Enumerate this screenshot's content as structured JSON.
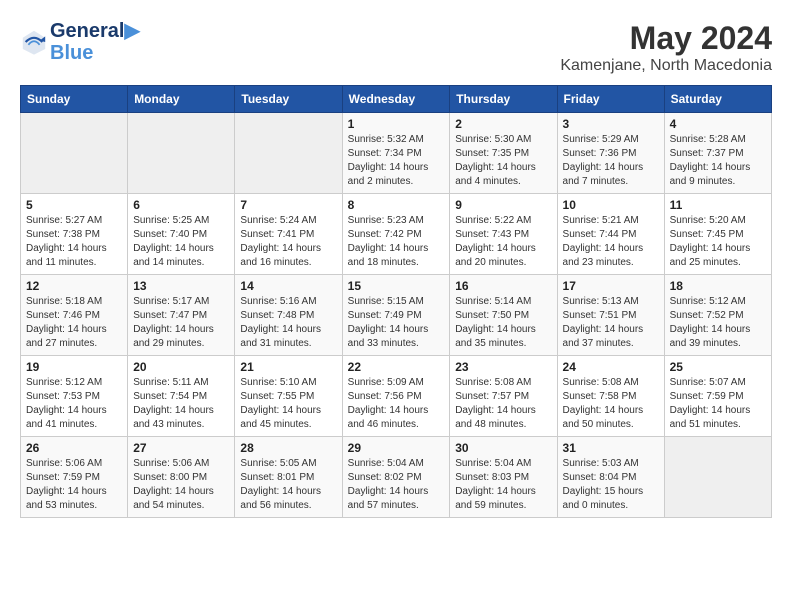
{
  "header": {
    "logo_line1": "General",
    "logo_line2": "Blue",
    "title": "May 2024",
    "subtitle": "Kamenjane, North Macedonia"
  },
  "weekdays": [
    "Sunday",
    "Monday",
    "Tuesday",
    "Wednesday",
    "Thursday",
    "Friday",
    "Saturday"
  ],
  "weeks": [
    [
      {
        "day": "",
        "empty": true
      },
      {
        "day": "",
        "empty": true
      },
      {
        "day": "",
        "empty": true
      },
      {
        "day": "1",
        "sunrise": "5:32 AM",
        "sunset": "7:34 PM",
        "daylight": "14 hours and 2 minutes."
      },
      {
        "day": "2",
        "sunrise": "5:30 AM",
        "sunset": "7:35 PM",
        "daylight": "14 hours and 4 minutes."
      },
      {
        "day": "3",
        "sunrise": "5:29 AM",
        "sunset": "7:36 PM",
        "daylight": "14 hours and 7 minutes."
      },
      {
        "day": "4",
        "sunrise": "5:28 AM",
        "sunset": "7:37 PM",
        "daylight": "14 hours and 9 minutes."
      }
    ],
    [
      {
        "day": "5",
        "sunrise": "5:27 AM",
        "sunset": "7:38 PM",
        "daylight": "14 hours and 11 minutes."
      },
      {
        "day": "6",
        "sunrise": "5:25 AM",
        "sunset": "7:40 PM",
        "daylight": "14 hours and 14 minutes."
      },
      {
        "day": "7",
        "sunrise": "5:24 AM",
        "sunset": "7:41 PM",
        "daylight": "14 hours and 16 minutes."
      },
      {
        "day": "8",
        "sunrise": "5:23 AM",
        "sunset": "7:42 PM",
        "daylight": "14 hours and 18 minutes."
      },
      {
        "day": "9",
        "sunrise": "5:22 AM",
        "sunset": "7:43 PM",
        "daylight": "14 hours and 20 minutes."
      },
      {
        "day": "10",
        "sunrise": "5:21 AM",
        "sunset": "7:44 PM",
        "daylight": "14 hours and 23 minutes."
      },
      {
        "day": "11",
        "sunrise": "5:20 AM",
        "sunset": "7:45 PM",
        "daylight": "14 hours and 25 minutes."
      }
    ],
    [
      {
        "day": "12",
        "sunrise": "5:18 AM",
        "sunset": "7:46 PM",
        "daylight": "14 hours and 27 minutes."
      },
      {
        "day": "13",
        "sunrise": "5:17 AM",
        "sunset": "7:47 PM",
        "daylight": "14 hours and 29 minutes."
      },
      {
        "day": "14",
        "sunrise": "5:16 AM",
        "sunset": "7:48 PM",
        "daylight": "14 hours and 31 minutes."
      },
      {
        "day": "15",
        "sunrise": "5:15 AM",
        "sunset": "7:49 PM",
        "daylight": "14 hours and 33 minutes."
      },
      {
        "day": "16",
        "sunrise": "5:14 AM",
        "sunset": "7:50 PM",
        "daylight": "14 hours and 35 minutes."
      },
      {
        "day": "17",
        "sunrise": "5:13 AM",
        "sunset": "7:51 PM",
        "daylight": "14 hours and 37 minutes."
      },
      {
        "day": "18",
        "sunrise": "5:12 AM",
        "sunset": "7:52 PM",
        "daylight": "14 hours and 39 minutes."
      }
    ],
    [
      {
        "day": "19",
        "sunrise": "5:12 AM",
        "sunset": "7:53 PM",
        "daylight": "14 hours and 41 minutes."
      },
      {
        "day": "20",
        "sunrise": "5:11 AM",
        "sunset": "7:54 PM",
        "daylight": "14 hours and 43 minutes."
      },
      {
        "day": "21",
        "sunrise": "5:10 AM",
        "sunset": "7:55 PM",
        "daylight": "14 hours and 45 minutes."
      },
      {
        "day": "22",
        "sunrise": "5:09 AM",
        "sunset": "7:56 PM",
        "daylight": "14 hours and 46 minutes."
      },
      {
        "day": "23",
        "sunrise": "5:08 AM",
        "sunset": "7:57 PM",
        "daylight": "14 hours and 48 minutes."
      },
      {
        "day": "24",
        "sunrise": "5:08 AM",
        "sunset": "7:58 PM",
        "daylight": "14 hours and 50 minutes."
      },
      {
        "day": "25",
        "sunrise": "5:07 AM",
        "sunset": "7:59 PM",
        "daylight": "14 hours and 51 minutes."
      }
    ],
    [
      {
        "day": "26",
        "sunrise": "5:06 AM",
        "sunset": "7:59 PM",
        "daylight": "14 hours and 53 minutes."
      },
      {
        "day": "27",
        "sunrise": "5:06 AM",
        "sunset": "8:00 PM",
        "daylight": "14 hours and 54 minutes."
      },
      {
        "day": "28",
        "sunrise": "5:05 AM",
        "sunset": "8:01 PM",
        "daylight": "14 hours and 56 minutes."
      },
      {
        "day": "29",
        "sunrise": "5:04 AM",
        "sunset": "8:02 PM",
        "daylight": "14 hours and 57 minutes."
      },
      {
        "day": "30",
        "sunrise": "5:04 AM",
        "sunset": "8:03 PM",
        "daylight": "14 hours and 59 minutes."
      },
      {
        "day": "31",
        "sunrise": "5:03 AM",
        "sunset": "8:04 PM",
        "daylight": "15 hours and 0 minutes."
      },
      {
        "day": "",
        "empty": true
      }
    ]
  ]
}
